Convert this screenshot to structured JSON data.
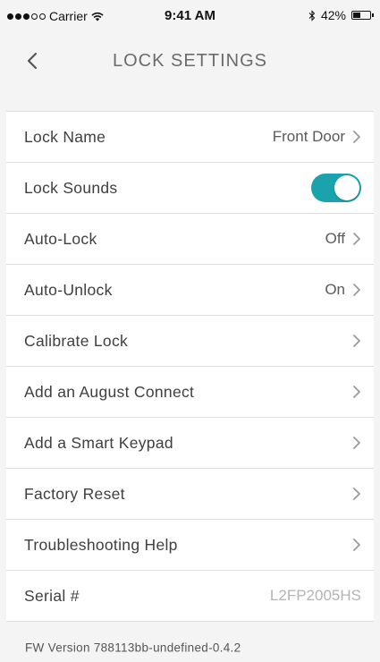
{
  "status_bar": {
    "carrier": "Carrier",
    "time": "9:41 AM",
    "battery": "42%",
    "battery_level": 0.42,
    "icons": [
      "signal-dots-icon",
      "wifi-icon",
      "bluetooth-icon",
      "battery-icon"
    ]
  },
  "nav": {
    "back_icon": "chevron-left-icon",
    "title": "LOCK SETTINGS"
  },
  "rows": [
    {
      "label": "Lock Name",
      "value": "Front Door",
      "accessory": "chevron"
    },
    {
      "label": "Lock Sounds",
      "value": "",
      "accessory": "toggle",
      "toggle_on": true
    },
    {
      "label": "Auto-Lock",
      "value": "Off",
      "accessory": "chevron"
    },
    {
      "label": "Auto-Unlock",
      "value": "On",
      "accessory": "chevron"
    },
    {
      "label": "Calibrate Lock",
      "value": "",
      "accessory": "chevron"
    },
    {
      "label": "Add an August Connect",
      "value": "",
      "accessory": "chevron"
    },
    {
      "label": "Add a Smart Keypad",
      "value": "",
      "accessory": "chevron"
    },
    {
      "label": "Factory Reset",
      "value": "",
      "accessory": "chevron"
    },
    {
      "label": "Troubleshooting Help",
      "value": "",
      "accessory": "chevron"
    },
    {
      "label": "Serial #",
      "value": "L2FP2005HS",
      "accessory": "none"
    }
  ],
  "footer": {
    "fw_version": "FW Version 788113bb-undefined-0.4.2"
  },
  "colors": {
    "accent": "#1aa3ad",
    "background": "#f4f4f4",
    "row_background": "#ffffff",
    "divider": "#dedede"
  }
}
